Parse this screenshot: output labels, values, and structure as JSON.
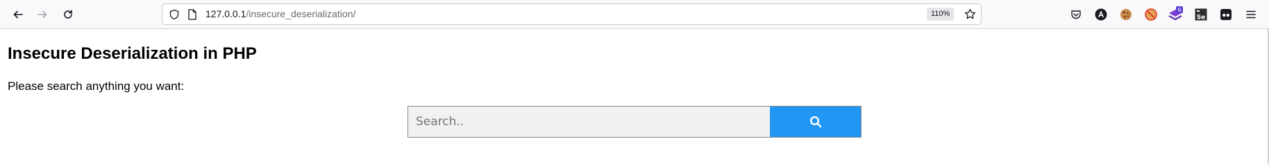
{
  "browser": {
    "url_host": "127.0.0.1",
    "url_path": "/insecure_deserialization/",
    "zoom_level": "110%",
    "extensions": [
      {
        "name": "pocket-icon"
      },
      {
        "name": "account-a-icon"
      },
      {
        "name": "cookie-icon"
      },
      {
        "name": "blocked-cookie-icon"
      },
      {
        "name": "extension-badge-icon",
        "badge": "6"
      },
      {
        "name": "selenium-ide-icon",
        "label": "Se"
      },
      {
        "name": "incognito-icon"
      },
      {
        "name": "menu-icon"
      }
    ]
  },
  "page": {
    "title": "Insecure Deserialization in PHP",
    "prompt": "Please search anything you want:",
    "search": {
      "placeholder": "Search..",
      "value": ""
    }
  },
  "colors": {
    "button": "#2196f3",
    "input_bg": "#f1f1f1",
    "toolbar_bg": "#f9f9fb"
  }
}
